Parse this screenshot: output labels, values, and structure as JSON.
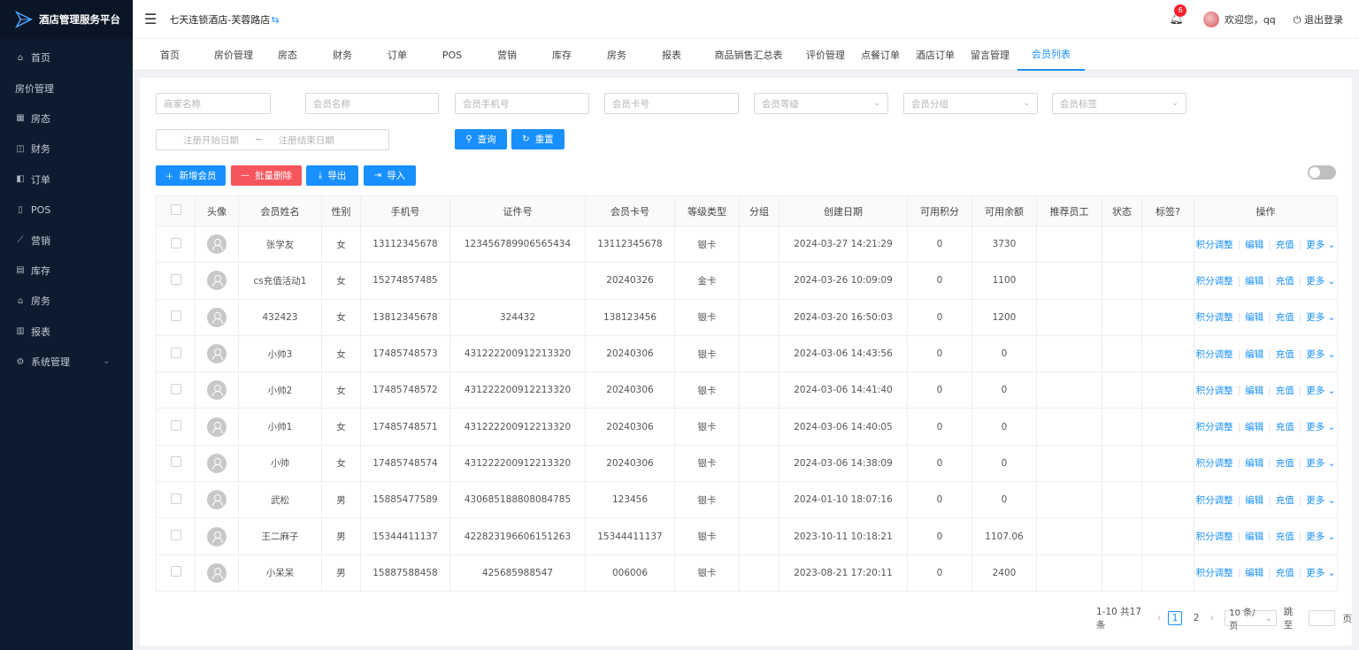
{
  "brand": {
    "title": "酒店管理服务平台"
  },
  "sidebar": {
    "items": [
      {
        "label": "首页",
        "icon": "home-icon",
        "glyph": "⌂"
      },
      {
        "label": "房价管理",
        "icon": "",
        "glyph": ""
      },
      {
        "label": "房态",
        "icon": "grid-icon",
        "glyph": "▦"
      },
      {
        "label": "财务",
        "icon": "wallet-icon",
        "glyph": "◫"
      },
      {
        "label": "订单",
        "icon": "order-icon",
        "glyph": "◧"
      },
      {
        "label": "POS",
        "icon": "pos-icon",
        "glyph": "▯"
      },
      {
        "label": "营销",
        "icon": "trend-icon",
        "glyph": "⟋"
      },
      {
        "label": "库存",
        "icon": "stock-icon",
        "glyph": "▤"
      },
      {
        "label": "房务",
        "icon": "building-icon",
        "glyph": "⌂"
      },
      {
        "label": "报表",
        "icon": "bar-chart-icon",
        "glyph": "▥"
      },
      {
        "label": "系统管理",
        "icon": "gear-icon",
        "glyph": "⚙",
        "arrow": "⌄"
      }
    ]
  },
  "topbar": {
    "hotel_name": "七天连锁酒店-芙蓉路店",
    "swap_glyph": "⇆",
    "notification_count": "6",
    "greeting": "欢迎您，qq",
    "logout": "退出登录"
  },
  "tabs": [
    {
      "label": "首页",
      "w": 84
    },
    {
      "label": "房价管理",
      "w": 60
    },
    {
      "label": "房态",
      "w": 62
    },
    {
      "label": "财务",
      "w": 62
    },
    {
      "label": "订单",
      "w": 62
    },
    {
      "label": "POS",
      "w": 62
    },
    {
      "label": "营销",
      "w": 62
    },
    {
      "label": "库存",
      "w": 62
    },
    {
      "label": "房务",
      "w": 62
    },
    {
      "label": "报表",
      "w": 62
    },
    {
      "label": "商品销售汇总表",
      "w": 112
    },
    {
      "label": "评价管理",
      "w": 62
    },
    {
      "label": "点餐订单",
      "w": 62
    },
    {
      "label": "酒店订单",
      "w": 62
    },
    {
      "label": "留言管理",
      "w": 62
    },
    {
      "label": "会员列表",
      "w": 76,
      "active": true
    }
  ],
  "filters": {
    "merchant_name": "商家名称",
    "member_name": "会员名称",
    "member_phone": "会员手机号",
    "member_card": "会员卡号",
    "member_level": "会员等级",
    "member_group": "会员分组",
    "member_tag": "会员标签",
    "reg_start": "注册开始日期",
    "range_sep": "~",
    "reg_end": "注册结束日期",
    "query": "查询",
    "reset": "重置"
  },
  "actions": {
    "add": "新增会员",
    "batch_delete": "批量删除",
    "export": "导出",
    "import": "导入"
  },
  "table": {
    "headers": [
      "",
      "头像",
      "会员姓名",
      "性别",
      "手机号",
      "证件号",
      "会员卡号",
      "等级类型",
      "分组",
      "创建日期",
      "可用积分",
      "可用余额",
      "推荐员工",
      "状态",
      "标签?",
      "操作"
    ],
    "rows": [
      {
        "name": "张学友",
        "gender": "女",
        "phone": "13112345678",
        "id_no": "123456789906565434",
        "card": "13112345678",
        "level": "银卡",
        "group": "",
        "created": "2024-03-27 14:21:29",
        "points": "0",
        "balance": "3730",
        "staff": "",
        "status": "",
        "tag": ""
      },
      {
        "name": "cs充值活动1",
        "gender": "女",
        "phone": "15274857485",
        "id_no": "",
        "card": "20240326",
        "level": "金卡",
        "group": "",
        "created": "2024-03-26 10:09:09",
        "points": "0",
        "balance": "1100",
        "staff": "",
        "status": "",
        "tag": ""
      },
      {
        "name": "432423",
        "gender": "女",
        "phone": "13812345678",
        "id_no": "324432",
        "card": "138123456",
        "level": "银卡",
        "group": "",
        "created": "2024-03-20 16:50:03",
        "points": "0",
        "balance": "1200",
        "staff": "",
        "status": "",
        "tag": ""
      },
      {
        "name": "小帅3",
        "gender": "女",
        "phone": "17485748573",
        "id_no": "431222200912213320",
        "card": "20240306",
        "level": "银卡",
        "group": "",
        "created": "2024-03-06 14:43:56",
        "points": "0",
        "balance": "0",
        "staff": "",
        "status": "",
        "tag": ""
      },
      {
        "name": "小帅2",
        "gender": "女",
        "phone": "17485748572",
        "id_no": "431222200912213320",
        "card": "20240306",
        "level": "银卡",
        "group": "",
        "created": "2024-03-06 14:41:40",
        "points": "0",
        "balance": "0",
        "staff": "",
        "status": "",
        "tag": ""
      },
      {
        "name": "小帅1",
        "gender": "女",
        "phone": "17485748571",
        "id_no": "431222200912213320",
        "card": "20240306",
        "level": "银卡",
        "group": "",
        "created": "2024-03-06 14:40:05",
        "points": "0",
        "balance": "0",
        "staff": "",
        "status": "",
        "tag": ""
      },
      {
        "name": "小帅",
        "gender": "女",
        "phone": "17485748574",
        "id_no": "431222200912213320",
        "card": "20240306",
        "level": "银卡",
        "group": "",
        "created": "2024-03-06 14:38:09",
        "points": "0",
        "balance": "0",
        "staff": "",
        "status": "",
        "tag": ""
      },
      {
        "name": "武松",
        "gender": "男",
        "phone": "15885477589",
        "id_no": "430685188808084785",
        "card": "123456",
        "level": "银卡",
        "group": "",
        "created": "2024-01-10 18:07:16",
        "points": "0",
        "balance": "0",
        "staff": "",
        "status": "",
        "tag": ""
      },
      {
        "name": "王二麻子",
        "gender": "男",
        "phone": "15344411137",
        "id_no": "422823196606151263",
        "card": "15344411137",
        "level": "银卡",
        "group": "",
        "created": "2023-10-11 10:18:21",
        "points": "0",
        "balance": "1107.06",
        "staff": "",
        "status": "",
        "tag": ""
      },
      {
        "name": "小呆呆",
        "gender": "男",
        "phone": "15887588458",
        "id_no": "425685988547",
        "card": "006006",
        "level": "银卡",
        "group": "",
        "created": "2023-08-21 17:20:11",
        "points": "0",
        "balance": "2400",
        "staff": "",
        "status": "",
        "tag": ""
      }
    ],
    "ops": {
      "points": "积分调整",
      "edit": "编辑",
      "recharge": "充值",
      "more": "更多"
    }
  },
  "pagination": {
    "summary": "1-10 共17条",
    "pages": [
      "1",
      "2"
    ],
    "current": "1",
    "page_size": "10 条/页",
    "jump_label": "跳至",
    "page_unit": "页"
  },
  "colors": {
    "primary": "#1890ff",
    "danger": "#f5555c",
    "sidebar": "#0d1b2e"
  }
}
